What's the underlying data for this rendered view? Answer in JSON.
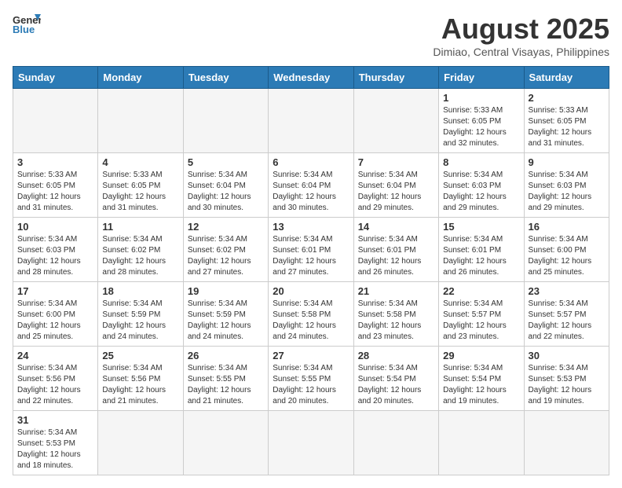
{
  "header": {
    "logo_general": "General",
    "logo_blue": "Blue",
    "month_title": "August 2025",
    "subtitle": "Dimiao, Central Visayas, Philippines"
  },
  "weekdays": [
    "Sunday",
    "Monday",
    "Tuesday",
    "Wednesday",
    "Thursday",
    "Friday",
    "Saturday"
  ],
  "weeks": [
    {
      "days": [
        {
          "date": "",
          "info": ""
        },
        {
          "date": "",
          "info": ""
        },
        {
          "date": "",
          "info": ""
        },
        {
          "date": "",
          "info": ""
        },
        {
          "date": "",
          "info": ""
        },
        {
          "date": "1",
          "info": "Sunrise: 5:33 AM\nSunset: 6:05 PM\nDaylight: 12 hours\nand 32 minutes."
        },
        {
          "date": "2",
          "info": "Sunrise: 5:33 AM\nSunset: 6:05 PM\nDaylight: 12 hours\nand 31 minutes."
        }
      ]
    },
    {
      "days": [
        {
          "date": "3",
          "info": "Sunrise: 5:33 AM\nSunset: 6:05 PM\nDaylight: 12 hours\nand 31 minutes."
        },
        {
          "date": "4",
          "info": "Sunrise: 5:33 AM\nSunset: 6:05 PM\nDaylight: 12 hours\nand 31 minutes."
        },
        {
          "date": "5",
          "info": "Sunrise: 5:34 AM\nSunset: 6:04 PM\nDaylight: 12 hours\nand 30 minutes."
        },
        {
          "date": "6",
          "info": "Sunrise: 5:34 AM\nSunset: 6:04 PM\nDaylight: 12 hours\nand 30 minutes."
        },
        {
          "date": "7",
          "info": "Sunrise: 5:34 AM\nSunset: 6:04 PM\nDaylight: 12 hours\nand 29 minutes."
        },
        {
          "date": "8",
          "info": "Sunrise: 5:34 AM\nSunset: 6:03 PM\nDaylight: 12 hours\nand 29 minutes."
        },
        {
          "date": "9",
          "info": "Sunrise: 5:34 AM\nSunset: 6:03 PM\nDaylight: 12 hours\nand 29 minutes."
        }
      ]
    },
    {
      "days": [
        {
          "date": "10",
          "info": "Sunrise: 5:34 AM\nSunset: 6:03 PM\nDaylight: 12 hours\nand 28 minutes."
        },
        {
          "date": "11",
          "info": "Sunrise: 5:34 AM\nSunset: 6:02 PM\nDaylight: 12 hours\nand 28 minutes."
        },
        {
          "date": "12",
          "info": "Sunrise: 5:34 AM\nSunset: 6:02 PM\nDaylight: 12 hours\nand 27 minutes."
        },
        {
          "date": "13",
          "info": "Sunrise: 5:34 AM\nSunset: 6:01 PM\nDaylight: 12 hours\nand 27 minutes."
        },
        {
          "date": "14",
          "info": "Sunrise: 5:34 AM\nSunset: 6:01 PM\nDaylight: 12 hours\nand 26 minutes."
        },
        {
          "date": "15",
          "info": "Sunrise: 5:34 AM\nSunset: 6:01 PM\nDaylight: 12 hours\nand 26 minutes."
        },
        {
          "date": "16",
          "info": "Sunrise: 5:34 AM\nSunset: 6:00 PM\nDaylight: 12 hours\nand 25 minutes."
        }
      ]
    },
    {
      "days": [
        {
          "date": "17",
          "info": "Sunrise: 5:34 AM\nSunset: 6:00 PM\nDaylight: 12 hours\nand 25 minutes."
        },
        {
          "date": "18",
          "info": "Sunrise: 5:34 AM\nSunset: 5:59 PM\nDaylight: 12 hours\nand 24 minutes."
        },
        {
          "date": "19",
          "info": "Sunrise: 5:34 AM\nSunset: 5:59 PM\nDaylight: 12 hours\nand 24 minutes."
        },
        {
          "date": "20",
          "info": "Sunrise: 5:34 AM\nSunset: 5:58 PM\nDaylight: 12 hours\nand 24 minutes."
        },
        {
          "date": "21",
          "info": "Sunrise: 5:34 AM\nSunset: 5:58 PM\nDaylight: 12 hours\nand 23 minutes."
        },
        {
          "date": "22",
          "info": "Sunrise: 5:34 AM\nSunset: 5:57 PM\nDaylight: 12 hours\nand 23 minutes."
        },
        {
          "date": "23",
          "info": "Sunrise: 5:34 AM\nSunset: 5:57 PM\nDaylight: 12 hours\nand 22 minutes."
        }
      ]
    },
    {
      "days": [
        {
          "date": "24",
          "info": "Sunrise: 5:34 AM\nSunset: 5:56 PM\nDaylight: 12 hours\nand 22 minutes."
        },
        {
          "date": "25",
          "info": "Sunrise: 5:34 AM\nSunset: 5:56 PM\nDaylight: 12 hours\nand 21 minutes."
        },
        {
          "date": "26",
          "info": "Sunrise: 5:34 AM\nSunset: 5:55 PM\nDaylight: 12 hours\nand 21 minutes."
        },
        {
          "date": "27",
          "info": "Sunrise: 5:34 AM\nSunset: 5:55 PM\nDaylight: 12 hours\nand 20 minutes."
        },
        {
          "date": "28",
          "info": "Sunrise: 5:34 AM\nSunset: 5:54 PM\nDaylight: 12 hours\nand 20 minutes."
        },
        {
          "date": "29",
          "info": "Sunrise: 5:34 AM\nSunset: 5:54 PM\nDaylight: 12 hours\nand 19 minutes."
        },
        {
          "date": "30",
          "info": "Sunrise: 5:34 AM\nSunset: 5:53 PM\nDaylight: 12 hours\nand 19 minutes."
        }
      ]
    },
    {
      "days": [
        {
          "date": "31",
          "info": "Sunrise: 5:34 AM\nSunset: 5:53 PM\nDaylight: 12 hours\nand 18 minutes."
        },
        {
          "date": "",
          "info": ""
        },
        {
          "date": "",
          "info": ""
        },
        {
          "date": "",
          "info": ""
        },
        {
          "date": "",
          "info": ""
        },
        {
          "date": "",
          "info": ""
        },
        {
          "date": "",
          "info": ""
        }
      ]
    }
  ]
}
